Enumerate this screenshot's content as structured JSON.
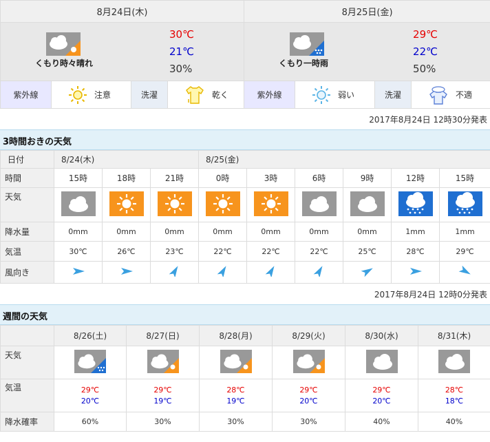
{
  "today_panel": [
    {
      "date": "8月24日(木)",
      "condition": "くもり時々晴れ",
      "icon": "cloudy-sometimes-sunny-icon",
      "high": "30℃",
      "low": "21℃",
      "pop": "30%",
      "uv_label": "紫外線",
      "uv_value": "注意",
      "uv_icon": "sun-outline-icon",
      "laundry_label": "洗濯",
      "laundry_value": "乾く",
      "laundry_icon": "shirt-icon"
    },
    {
      "date": "8月25日(金)",
      "condition": "くもり一時雨",
      "icon": "cloudy-occasional-rain-icon",
      "high": "29℃",
      "low": "22℃",
      "pop": "50%",
      "uv_label": "紫外線",
      "uv_value": "弱い",
      "uv_icon": "weak-sun-outline-icon",
      "laundry_label": "洗濯",
      "laundry_value": "不適",
      "laundry_icon": "shirt-rain-icon"
    }
  ],
  "today_published": "2017年8月24日 12時30分発表",
  "hourly": {
    "title": "3時間おきの天気",
    "labels": {
      "date": "日付",
      "time": "時間",
      "weather": "天気",
      "rain": "降水量",
      "temp": "気温",
      "wind": "風向き"
    },
    "dates": [
      "8/24(木)",
      "8/25(金)"
    ],
    "times": [
      "15時",
      "18時",
      "21時",
      "0時",
      "3時",
      "6時",
      "9時",
      "12時",
      "15時"
    ],
    "weather": [
      "cloudy",
      "sunny",
      "sunny",
      "sunny",
      "sunny",
      "cloudy",
      "cloudy",
      "rain",
      "rain"
    ],
    "rain": [
      "0mm",
      "0mm",
      "0mm",
      "0mm",
      "0mm",
      "0mm",
      "0mm",
      "1mm",
      "1mm"
    ],
    "temp": [
      "30℃",
      "26℃",
      "23℃",
      "22℃",
      "22℃",
      "22℃",
      "25℃",
      "28℃",
      "29℃"
    ],
    "wind_direction_deg": [
      0,
      0,
      -60,
      -60,
      -60,
      -60,
      -30,
      0,
      30
    ],
    "published": "2017年8月24日 12時0分発表"
  },
  "weekly": {
    "title": "週間の天気",
    "labels": {
      "weather": "天気",
      "temp": "気温",
      "pop": "降水確率"
    },
    "dates": [
      "8/26(土)",
      "8/27(日)",
      "8/28(月)",
      "8/29(火)",
      "8/30(水)",
      "8/31(木)"
    ],
    "weather": [
      "cloud-rain",
      "cloud-sun",
      "cloud-sun",
      "cloud-sun",
      "cloudy",
      "cloudy"
    ],
    "highs": [
      "29℃",
      "29℃",
      "28℃",
      "29℃",
      "29℃",
      "28℃"
    ],
    "lows": [
      "20℃",
      "19℃",
      "19℃",
      "20℃",
      "20℃",
      "18℃"
    ],
    "pops": [
      "60%",
      "30%",
      "30%",
      "30%",
      "40%",
      "40%"
    ]
  },
  "colors": {
    "high_temp": "#e60000",
    "low_temp": "#0000cc",
    "sunny_bg": "#f7941d",
    "rain_bg": "#1f6fd1",
    "cloudy_bg": "#999999",
    "wind_arrow": "#3aa0e0"
  }
}
